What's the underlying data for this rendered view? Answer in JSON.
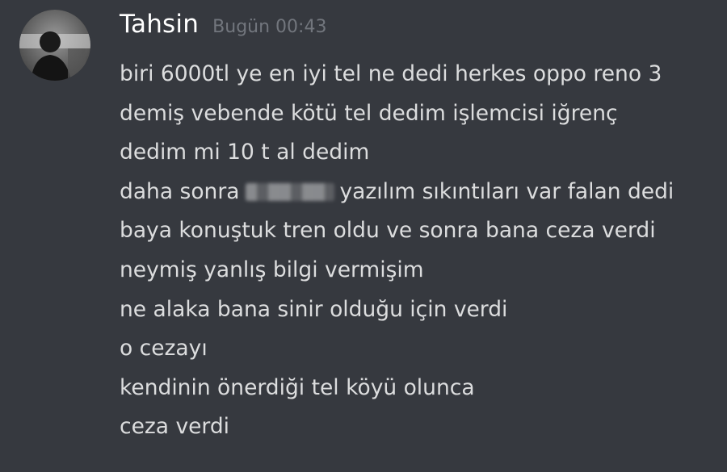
{
  "message": {
    "author": "Tahsin",
    "timestamp": "Bugün 00:43",
    "avatar_icon": "user-avatar-icon",
    "lines": [
      "biri 6000tl ye en iyi tel ne dedi herkes oppo reno 3",
      "demiş vebende kötü tel dedim işlemcisi iğrenç",
      "dedim mi 10 t al dedim",
      "daha sonra",
      "yazılım sıkıntıları var falan dedi",
      "baya konuştuk tren oldu ve sonra bana ceza verdi",
      "neymiş yanlış bilgi vermişim",
      "ne alaka bana sinir olduğu için verdi",
      "o cezayı",
      "kendinin önerdiği tel köyü olunca",
      "ceza verdi"
    ]
  },
  "colors": {
    "background": "#36393f",
    "username": "#ffffff",
    "timestamp": "#72767d",
    "text": "#dcddde"
  }
}
